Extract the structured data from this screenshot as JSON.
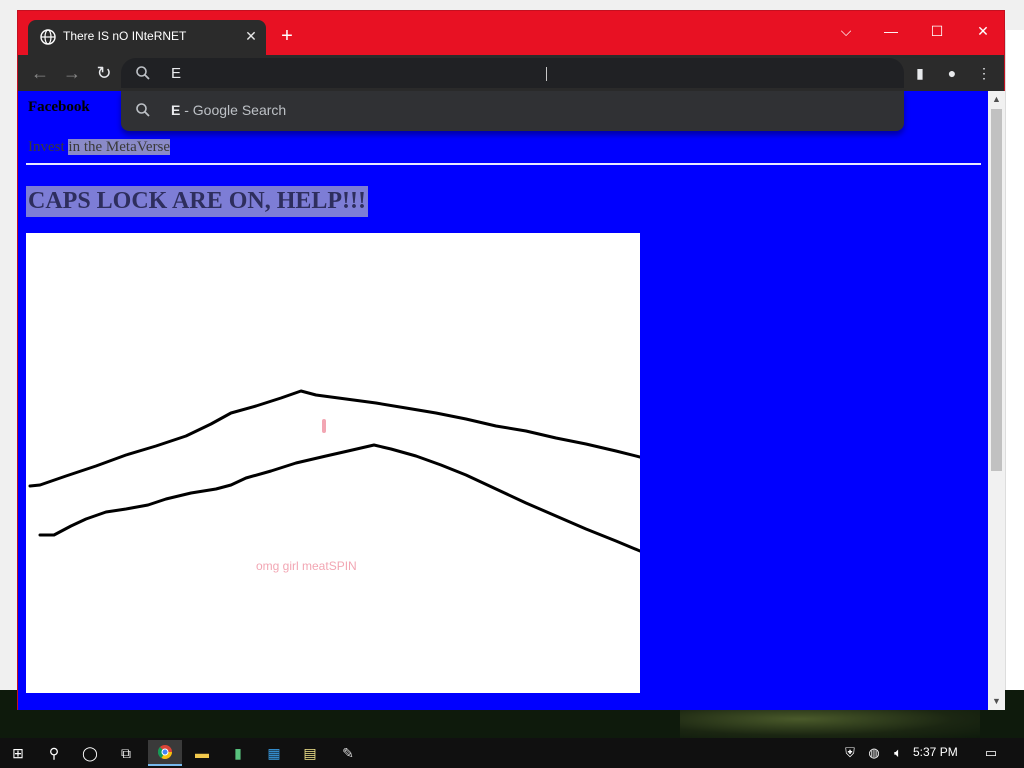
{
  "browser": {
    "tab_title": "There IS nO INteRNET",
    "tab_close": "✕",
    "new_tab": "+",
    "window_controls": {
      "dropdown": "⌵",
      "minimize": "—",
      "maximize": "☐",
      "close": "✕"
    }
  },
  "omnibox": {
    "value": "E",
    "suggestion_bold": "E",
    "suggestion_rest": " - Google Search"
  },
  "page": {
    "facebook_link": "Facebook",
    "invest_before": "Invest ",
    "invest_selected": "in the MetaVerse",
    "caps_heading": "CAPS LOCK ARE ON, HELP!!!",
    "drawing_caption": "omg girl meatSPIN"
  },
  "taskbar": {
    "time": "5:37 PM"
  },
  "colors": {
    "titlebar": "#e81123",
    "page_bg": "#0000ff",
    "selection": "#7d7dd6",
    "caption_pink": "#f2a6b3"
  }
}
